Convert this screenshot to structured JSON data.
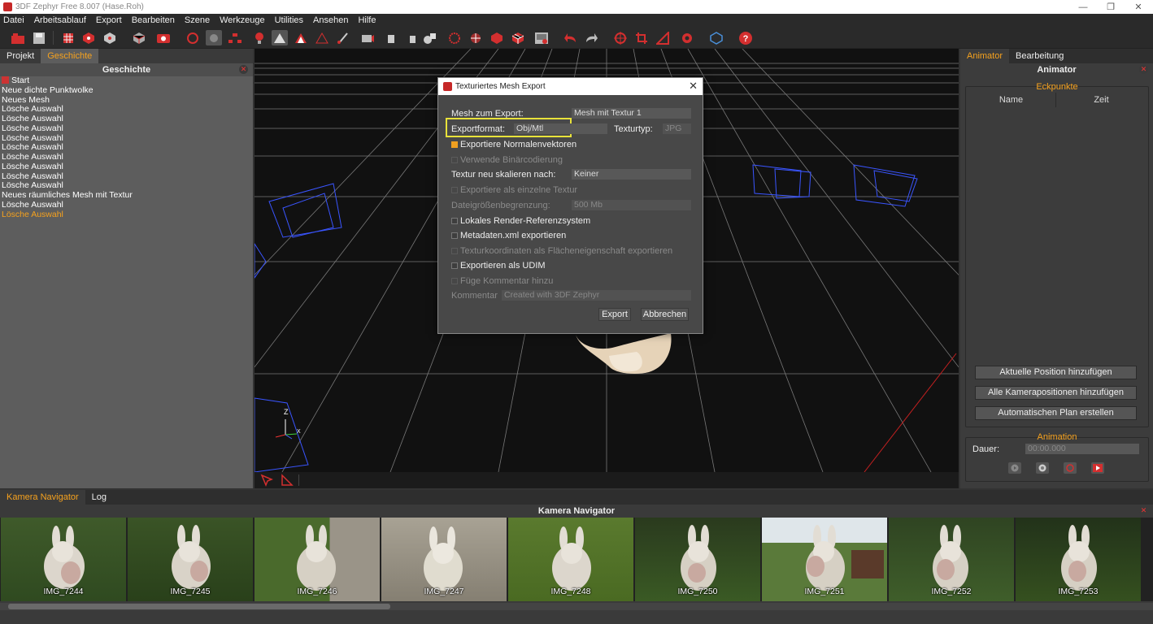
{
  "window": {
    "title": "3DF Zephyr Free 8.007 (Hase.Roh)"
  },
  "menu": [
    "Datei",
    "Arbeitsablauf",
    "Export",
    "Bearbeiten",
    "Szene",
    "Werkzeuge",
    "Utilities",
    "Ansehen",
    "Hilfe"
  ],
  "left_panel": {
    "tabs": [
      "Projekt",
      "Geschichte"
    ],
    "active_tab": "Geschichte",
    "title": "Geschichte",
    "history": [
      "Start",
      "Neue dichte Punktwolke",
      "Neues Mesh",
      "Lösche Auswahl",
      "Lösche Auswahl",
      "Lösche Auswahl",
      "Lösche Auswahl",
      "Lösche Auswahl",
      "Lösche Auswahl",
      "Lösche Auswahl",
      "Lösche Auswahl",
      "Lösche Auswahl",
      "Neues räumliches Mesh mit Textur",
      "Lösche Auswahl",
      "Lösche Auswahl"
    ]
  },
  "viewport": {
    "axis_z": "Z",
    "axis_x": "X"
  },
  "dialog": {
    "title": "Texturiertes Mesh Export",
    "mesh_label": "Mesh zum Export:",
    "mesh_value": "Mesh mit Textur 1",
    "format_label": "Exportformat:",
    "format_value": "Obj/Mtl",
    "texture_type_label": "Texturtyp:",
    "texture_type_value": "JPG",
    "export_normals": "Exportiere Normalenvektoren",
    "binary": "Verwende Binärcodierung",
    "rescale_label": "Textur neu skalieren nach:",
    "rescale_value": "Keiner",
    "single_texture": "Exportiere als einzelne Textur",
    "filesize_label": "Dateigrößenbegrenzung:",
    "filesize_value": "500 Mb",
    "local_ref": "Lokales Render-Referenzsystem",
    "metadata": "Metadaten.xml exportieren",
    "texcoords": "Texturkoordinaten als Flächeneigenschaft exportieren",
    "udim": "Exportieren als UDIM",
    "add_comment": "Füge Kommentar hinzu",
    "comment_label": "Kommentar",
    "comment_value": "Created with 3DF Zephyr",
    "export_btn": "Export",
    "cancel_btn": "Abbrechen"
  },
  "right_panel": {
    "tabs": [
      "Animator",
      "Bearbeitung"
    ],
    "active_tab": "Animator",
    "title": "Animator",
    "keypoints_label": "Eckpunkte",
    "col_name": "Name",
    "col_time": "Zeit",
    "btn_add_current": "Aktuelle Position hinzufügen",
    "btn_add_all": "Alle Kamerapositionen hinzufügen",
    "btn_auto": "Automatischen Plan erstellen",
    "animation_label": "Animation",
    "duration_label": "Dauer:",
    "duration_value": "00:00.000"
  },
  "bottom_panel": {
    "tabs": [
      "Kamera Navigator",
      "Log"
    ],
    "active_tab": "Kamera Navigator",
    "title": "Kamera Navigator",
    "images": [
      "IMG_7244",
      "IMG_7245",
      "IMG_7246",
      "IMG_7247",
      "IMG_7248",
      "IMG_7250",
      "IMG_7251",
      "IMG_7252",
      "IMG_7253"
    ]
  },
  "colors": {
    "accent": "#f6a21e",
    "brand_red": "#c62828",
    "highlight": "#e8e23a"
  }
}
